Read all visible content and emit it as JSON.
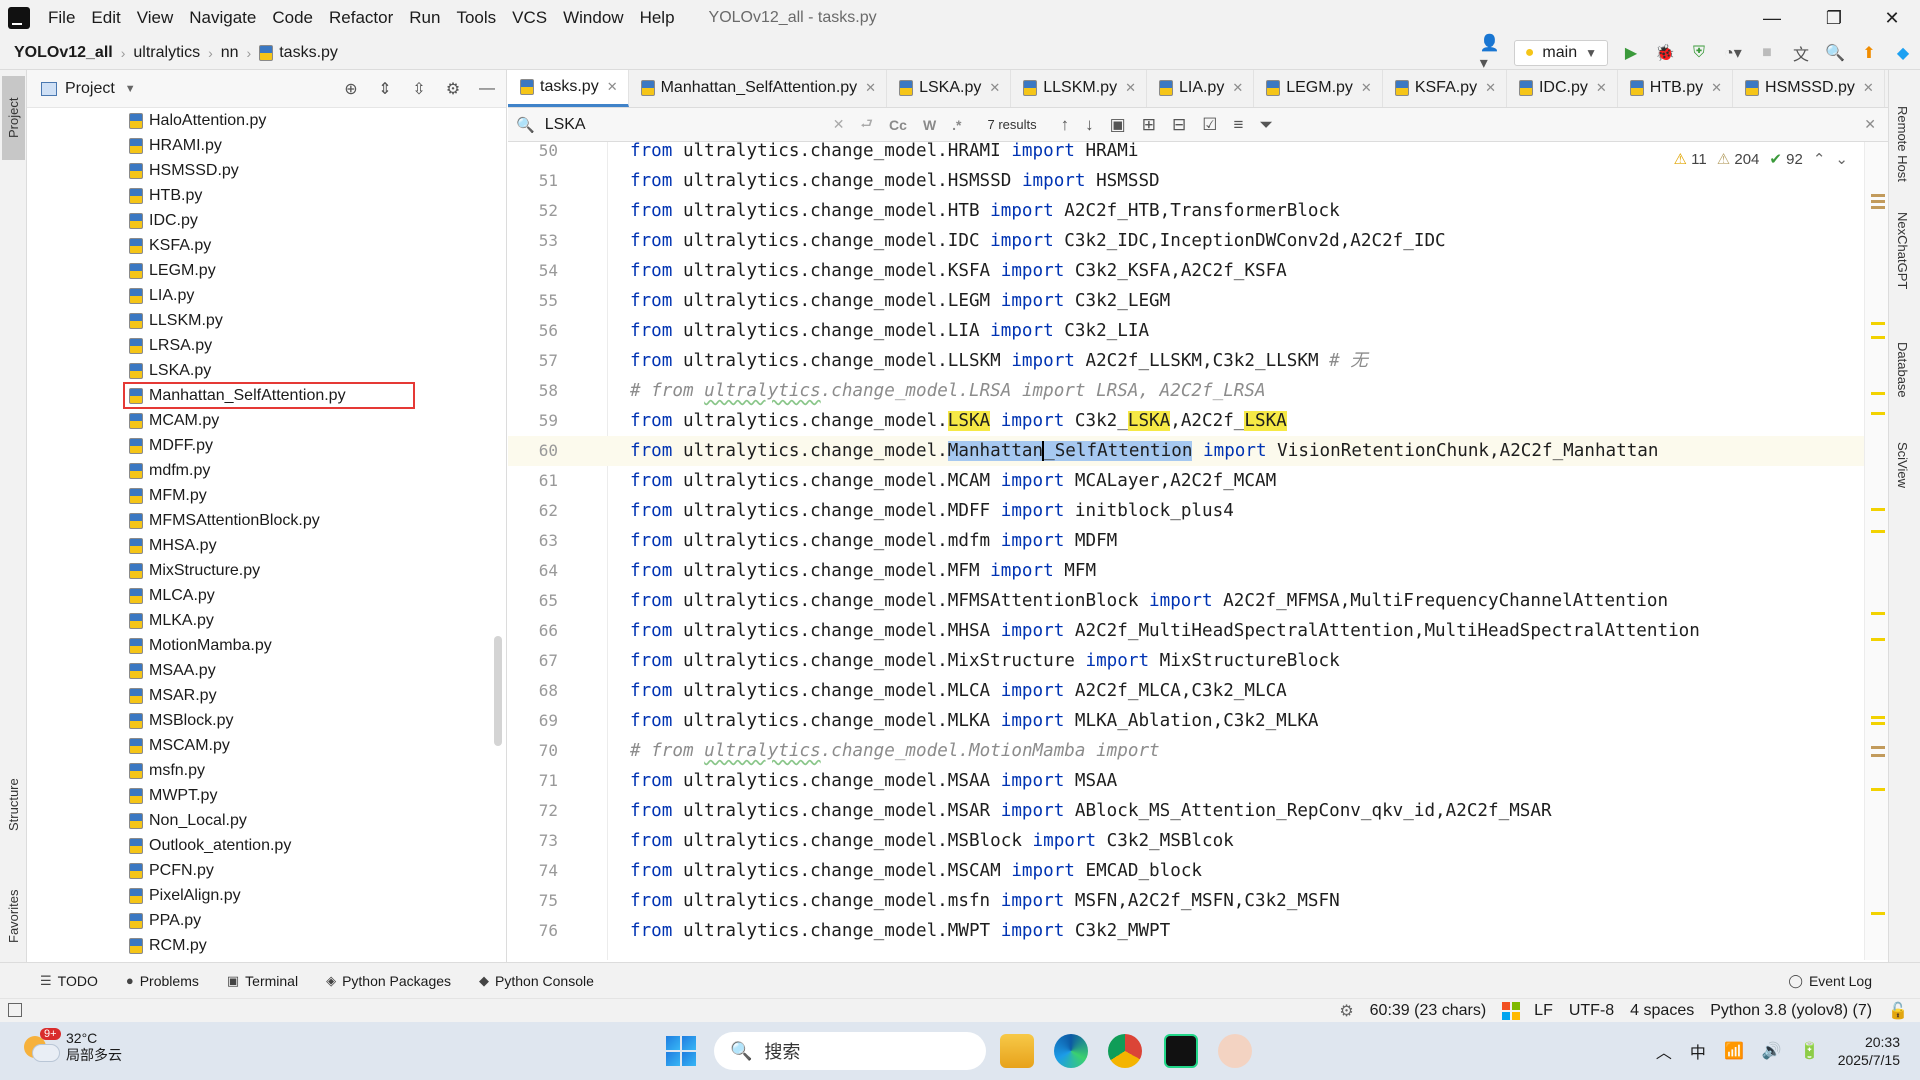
{
  "window": {
    "title": "YOLOv12_all - tasks.py",
    "menus": [
      "File",
      "Edit",
      "View",
      "Navigate",
      "Code",
      "Refactor",
      "Run",
      "Tools",
      "VCS",
      "Window",
      "Help"
    ],
    "controls": {
      "minimize": "—",
      "maximize": "❐",
      "close": "✕"
    }
  },
  "breadcrumb": [
    "YOLOv12_all",
    "ultralytics",
    "nn",
    "tasks.py"
  ],
  "toolbar": {
    "branch": "main"
  },
  "left_strip": {
    "project": "Project",
    "structure": "Structure",
    "favorites": "Favorites"
  },
  "project_panel": {
    "title": "Project",
    "files": [
      "HaloAttention.py",
      "HRAMI.py",
      "HSMSSD.py",
      "HTB.py",
      "IDC.py",
      "KSFA.py",
      "LEGM.py",
      "LIA.py",
      "LLSKM.py",
      "LRSA.py",
      "LSKA.py",
      "Manhattan_SelfAttention.py",
      "MCAM.py",
      "MDFF.py",
      "mdfm.py",
      "MFM.py",
      "MFMSAttentionBlock.py",
      "MHSA.py",
      "MixStructure.py",
      "MLCA.py",
      "MLKA.py",
      "MotionMamba.py",
      "MSAA.py",
      "MSAR.py",
      "MSBlock.py",
      "MSCAM.py",
      "msfn.py",
      "MWPT.py",
      "Non_Local.py",
      "Outlook_atention.py",
      "PCFN.py",
      "PixelAlign.py",
      "PPA.py",
      "RCM.py"
    ],
    "highlighted_file": "Manhattan_SelfAttention.py"
  },
  "tabs": [
    "tasks.py",
    "Manhattan_SelfAttention.py",
    "LSKA.py",
    "LLSKM.py",
    "LIA.py",
    "LEGM.py",
    "KSFA.py",
    "IDC.py",
    "HTB.py",
    "HSMSSD.py"
  ],
  "find": {
    "query": "LSKA",
    "options": [
      "Cc",
      "W",
      ".*"
    ],
    "results": "7 results"
  },
  "inspections": {
    "warnings": "11",
    "weak_warnings": "204",
    "ok": "92"
  },
  "code": {
    "current_line": "60",
    "lines": [
      {
        "n": "50",
        "kind": "import",
        "module": "ultralytics.change_model.HRAMI",
        "names": "HRAMi"
      },
      {
        "n": "51",
        "kind": "import",
        "module": "ultralytics.change_model.HSMSSD",
        "names": "HSMSSD"
      },
      {
        "n": "52",
        "kind": "import",
        "module": "ultralytics.change_model.HTB",
        "names": "A2C2f_HTB,TransformerBlock"
      },
      {
        "n": "53",
        "kind": "import",
        "module": "ultralytics.change_model.IDC",
        "names": "C3k2_IDC,InceptionDWConv2d,A2C2f_IDC"
      },
      {
        "n": "54",
        "kind": "import",
        "module": "ultralytics.change_model.KSFA",
        "names": "C3k2_KSFA,A2C2f_KSFA"
      },
      {
        "n": "55",
        "kind": "import",
        "module": "ultralytics.change_model.LEGM",
        "names": "C3k2_LEGM"
      },
      {
        "n": "56",
        "kind": "import",
        "module": "ultralytics.change_model.LIA",
        "names": "C3k2_LIA"
      },
      {
        "n": "57",
        "kind": "import_comment",
        "module": "ultralytics.change_model.LLSKM",
        "names": "A2C2f_LLSKM,C3k2_LLSKM",
        "comment": " # 无"
      },
      {
        "n": "58",
        "kind": "comment",
        "text": "# from ultralytics.change_model.LRSA import LRSA, A2C2f_LRSA"
      },
      {
        "n": "59",
        "kind": "lska"
      },
      {
        "n": "60",
        "kind": "manhattan"
      },
      {
        "n": "61",
        "kind": "import",
        "module": "ultralytics.change_model.MCAM",
        "names": "MCALayer,A2C2f_MCAM"
      },
      {
        "n": "62",
        "kind": "import",
        "module": "ultralytics.change_model.MDFF",
        "names": "initblock_plus4"
      },
      {
        "n": "63",
        "kind": "import",
        "module": "ultralytics.change_model.mdfm",
        "names": "MDFM"
      },
      {
        "n": "64",
        "kind": "import",
        "module": "ultralytics.change_model.MFM",
        "names": "MFM"
      },
      {
        "n": "65",
        "kind": "import",
        "module": "ultralytics.change_model.MFMSAttentionBlock",
        "names": "A2C2f_MFMSA,MultiFrequencyChannelAttention"
      },
      {
        "n": "66",
        "kind": "import",
        "module": "ultralytics.change_model.MHSA",
        "names": "A2C2f_MultiHeadSpectralAttention,MultiHeadSpectralAttention"
      },
      {
        "n": "67",
        "kind": "import",
        "module": "ultralytics.change_model.MixStructure",
        "names": "MixStructureBlock"
      },
      {
        "n": "68",
        "kind": "import",
        "module": "ultralytics.change_model.MLCA",
        "names": "A2C2f_MLCA,C3k2_MLCA"
      },
      {
        "n": "69",
        "kind": "import",
        "module": "ultralytics.change_model.MLKA",
        "names": "MLKA_Ablation,C3k2_MLKA"
      },
      {
        "n": "70",
        "kind": "comment",
        "text": "# from ultralytics.change_model.MotionMamba import"
      },
      {
        "n": "71",
        "kind": "import",
        "module": "ultralytics.change_model.MSAA",
        "names": "MSAA"
      },
      {
        "n": "72",
        "kind": "import",
        "module": "ultralytics.change_model.MSAR",
        "names": "ABlock_MS_Attention_RepConv_qkv_id,A2C2f_MSAR"
      },
      {
        "n": "73",
        "kind": "import",
        "module": "ultralytics.change_model.MSBlock",
        "names": "C3k2_MSBlcok"
      },
      {
        "n": "74",
        "kind": "import",
        "module": "ultralytics.change_model.MSCAM",
        "names": "EMCAD_block"
      },
      {
        "n": "75",
        "kind": "import",
        "module": "ultralytics.change_model.msfn",
        "names": "MSFN,A2C2f_MSFN,C3k2_MSFN"
      },
      {
        "n": "76",
        "kind": "import",
        "module": "ultralytics.change_model.MWPT",
        "names": "C3k2_MWPT"
      }
    ],
    "lska_line": {
      "pre": "ultralytics.change_model.",
      "hit": "LSKA",
      "kw": "import",
      "a": "C3k2_",
      "b": ",A2C2f_"
    },
    "manhattan_line": {
      "pre": "ultralytics.change_model.",
      "sel_a": "Manhattan",
      "sel_b": "_SelfAttention",
      "kw": "import",
      "names": "VisionRetentionChunk,A2C2f_Manhattan"
    },
    "keywords": {
      "from": "from",
      "import": "import"
    }
  },
  "right_strip": [
    "Remote Host",
    "NexChatGPT",
    "Database",
    "SciView"
  ],
  "tool_windows": [
    "TODO",
    "Problems",
    "Terminal",
    "Python Packages",
    "Python Console"
  ],
  "event_log": "Event Log",
  "status": {
    "position": "60:39 (23 chars)",
    "line_sep": "LF",
    "encoding": "UTF-8",
    "indent": "4 spaces",
    "interpreter": "Python 3.8 (yolov8) (7)"
  },
  "taskbar": {
    "weather_badge": "9+",
    "temperature": "32°C",
    "weather_desc": "局部多云",
    "search_placeholder": "搜索",
    "ime": "中",
    "time": "20:33",
    "date": "2025/7/15"
  },
  "colors": {
    "keyword": "#0033b3",
    "search_hit": "#f6e946",
    "selection": "#a6c8f0",
    "active_tab_border": "#4083c9",
    "annotation_box": "#e53935"
  }
}
